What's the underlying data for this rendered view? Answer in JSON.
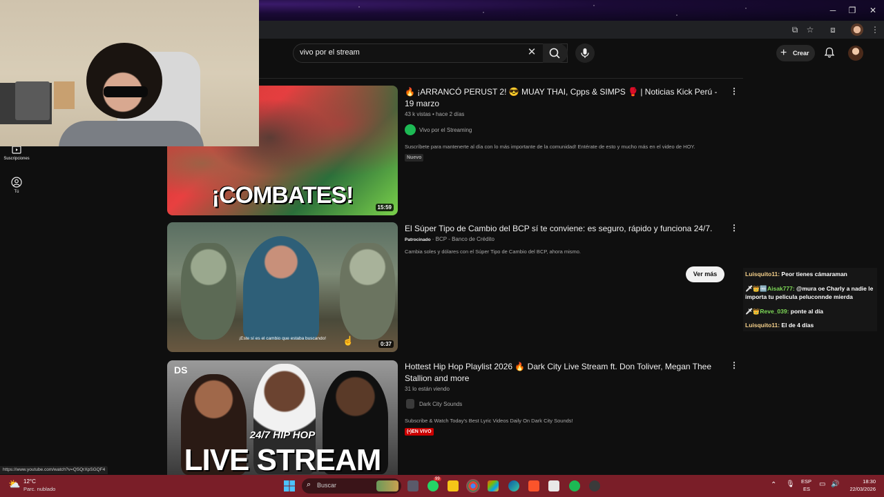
{
  "search": {
    "query": "vivo por el stream"
  },
  "header": {
    "create_label": "Crear"
  },
  "sidebar": {
    "items": [
      {
        "label": "Suscripciones",
        "icon": "subscriptions-icon"
      },
      {
        "label": "Tú",
        "icon": "user-circle-icon"
      }
    ]
  },
  "videos": [
    {
      "title": "🔥 ¡ARRANCÓ PERUST 2! 😎 MUAY THAI, Cpps & SIMPS 🥊 | Noticias Kick Perú - 19 marzo",
      "views": "43 k vistas",
      "age": "hace 2 días",
      "channel": "Vivo por el Streaming",
      "description": "Suscríbete para mantenerte al día con lo más importante de la comunidad! Entérate de esto y mucho más en el video de HOY.",
      "badge": "Nuevo",
      "duration": "15:59",
      "thumb_text": "¡COMBATES!"
    },
    {
      "title": "El Súper Tipo de Cambio del BCP sí te conviene: es seguro, rápido y funciona 24/7.",
      "sponsored": "Patrocinado",
      "channel": "BCP - Banco de Crédito",
      "description": "Cambia soles y dólares con el Súper Tipo de Cambio del BCP, ahora mismo.",
      "duration": "0:37",
      "caption": "¡Este sí es el cambio que estaba buscando!",
      "cta": "Ver más"
    },
    {
      "title": "Hottest Hip Hop Playlist 2026 🔥 Dark City Live Stream ft. Don Toliver, Megan Thee Stallion and more",
      "watching": "31 lo están viendo",
      "channel": "Dark City Sounds",
      "description": "Subscribe & Watch Today's Best Lyric Videos Daily On Dark City Sounds!",
      "badge": "EN VIVO",
      "thumb_small": "24/7 HIP HOP",
      "thumb_big": "LIVE STREAM",
      "thumb_logo": "DS"
    }
  ],
  "chat": [
    {
      "user": "Luisquito11:",
      "message": " Peor tienes cámaraman",
      "prefix": "",
      "color": "#f5d08a"
    },
    {
      "user": "Aisak777:",
      "message": " @mura oe Charly a nadie le importa tu pelicula peluconnde mierda",
      "prefix": "🗡👑🆓",
      "color": "#7ed957"
    },
    {
      "user": "Reve_039:",
      "message": " ponte al día",
      "prefix": "🗡👑",
      "color": "#7ed957"
    },
    {
      "user": "Luisquito11:",
      "message": " El de 4 días",
      "prefix": "",
      "color": "#f5d08a"
    }
  ],
  "status_url": "https://www.youtube.com/watch?v=QSQrXpSGQF4",
  "taskbar": {
    "temperature": "12°C",
    "weather": "Parc. nublado",
    "search_placeholder": "Buscar",
    "lang_1": "ESP",
    "lang_2": "ES",
    "time": "18:30",
    "date": "22/03/2026",
    "notification_count": "99"
  },
  "colors": {
    "background": "#0f0f0f",
    "live_red": "#cc0000",
    "taskbar": "#7a1e28",
    "channel_green": "#1db954"
  }
}
